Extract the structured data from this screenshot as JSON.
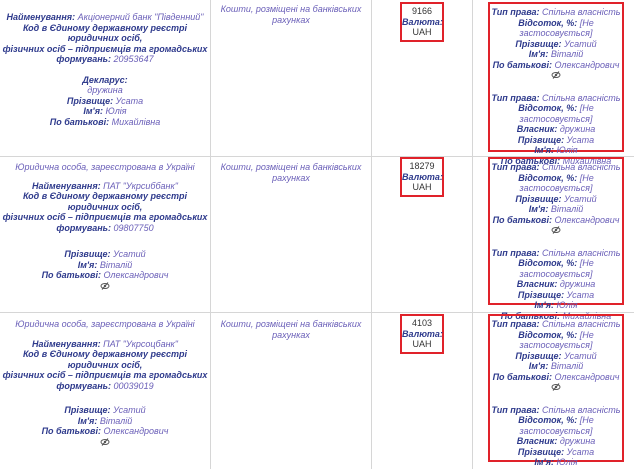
{
  "labels": {
    "entity_type": "Юридична особа, зареєстрована в Україні",
    "name": "Найменування:",
    "code_l1": "Код в Єдиному державному реєстрі юридичних осіб,",
    "code_l2": "фізичних осіб – підприємців та громадських",
    "code_l3": "формувань:",
    "surname": "Прізвище:",
    "firstname": "Ім'я:",
    "patronymic": "По батькові:",
    "asset_type": "Кошти, розміщені на банківських рахунках",
    "currency": "Валюта:",
    "currency_value": "UAH",
    "right_type": "Тип права:",
    "joint": "Спільна власність",
    "percent": "Відсоток, %:",
    "not_applied": "[Не застосовується]",
    "owner": "Власник:",
    "wife_relation": "дружина"
  },
  "people": {
    "husband": {
      "surname": "Усатий",
      "firstname": "Віталій",
      "patronymic": "Олександрович"
    },
    "wife": {
      "surname": "Усата",
      "firstname": "Юлія",
      "patronymic": "Михайлівна"
    }
  },
  "rows": [
    {
      "bank_name": "Акціонерний банк \"Південний\"",
      "code": "20953647",
      "owner_label": "Декларус:",
      "owner_relation": "дружина",
      "surname": "Усата",
      "firstname": "Юлія",
      "patronymic": "Михайлівна",
      "amount": "9166"
    },
    {
      "bank_name": "ПАТ \"Укрсиббанк\"",
      "code": "09807750",
      "amount": "18279"
    },
    {
      "bank_name": "ПАТ \"Укрсоцбанк\"",
      "code": "00039019",
      "amount": "4103"
    }
  ],
  "colors": {
    "highlight_border": "#e0222a",
    "label_text": "#2e3a8c",
    "value_text": "#6a5fb8",
    "grid_line": "#d6d6d6"
  },
  "icons": [
    "eye-icon"
  ]
}
